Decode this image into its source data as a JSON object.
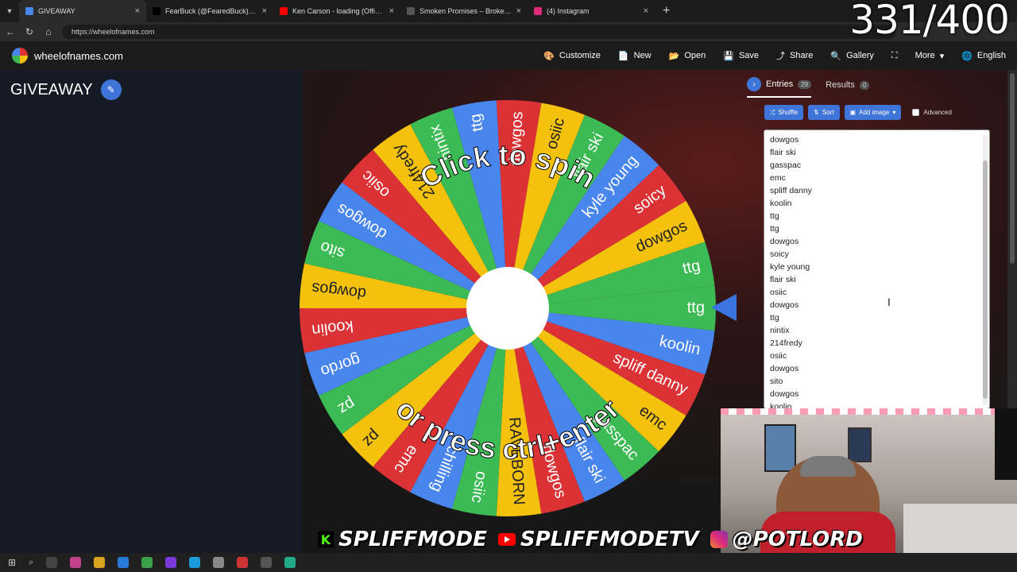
{
  "browser": {
    "tabs": [
      {
        "title": "GIVEAWAY",
        "fav": "#4885ed",
        "active": true
      },
      {
        "title": "FearBuck (@FearedBuck) / X",
        "fav": "#000000"
      },
      {
        "title": "Ken Carson - loading (Official",
        "fav": "#ff0000"
      },
      {
        "title": "Smoken Promises – Broken Promi",
        "fav": "#555555"
      },
      {
        "title": "(4) Instagram",
        "fav": "#dd2a7b"
      }
    ],
    "url": "https://wheelofnames.com"
  },
  "site": {
    "logo_text": "wheelofnames.com",
    "menu": [
      {
        "icon": "palette-icon",
        "glyph": "🎨",
        "label": "Customize"
      },
      {
        "icon": "new-file-icon",
        "glyph": "📄",
        "label": "New"
      },
      {
        "icon": "folder-icon",
        "glyph": "📂",
        "label": "Open"
      },
      {
        "icon": "save-icon",
        "glyph": "💾",
        "label": "Save"
      },
      {
        "icon": "share-icon",
        "glyph": "⤴",
        "label": "Share"
      },
      {
        "icon": "search-icon",
        "glyph": "🔍",
        "label": "Gallery"
      },
      {
        "icon": "fullscreen-icon",
        "glyph": "⛶",
        "label": ""
      },
      {
        "icon": "chevron-down-icon",
        "glyph": "▾",
        "label": "More"
      },
      {
        "icon": "globe-icon",
        "glyph": "🌐",
        "label": "English"
      }
    ]
  },
  "wheel": {
    "title": "GIVEAWAY",
    "click_text": "Click to spin",
    "press_text": "or press ctrl+enter",
    "colors": [
      "#3cba54",
      "#4885ed",
      "#db3236",
      "#f4c20d"
    ],
    "segments": [
      "ttg",
      "koolin",
      "spliff danny",
      "emc",
      "gasspac",
      "flair ski",
      "dowgos",
      "RAVEBORN",
      "osiic",
      "chilling",
      "emc",
      "pz",
      "pz",
      "gordo",
      "koolin",
      "dowgos",
      "sito",
      "dowgos",
      "osiic",
      "214fredy",
      "nintix",
      "ttg",
      "dowgos",
      "osiic",
      "flair ski",
      "kyle young",
      "soicy",
      "dowgos",
      "ttg"
    ]
  },
  "panel": {
    "entries_tab": "Entries",
    "entries_count": "29",
    "results_tab": "Results",
    "results_count": "0",
    "shuffle": "Shuffle",
    "sort": "Sort",
    "add_image": "Add image",
    "advanced": "Advanced",
    "entries": [
      "dowgos",
      "flair ski",
      "gasspac",
      "emc",
      "spliff danny",
      "koolin",
      "ttg",
      "ttg",
      "dowgos",
      "soicy",
      "kyle young",
      "flair ski",
      "osiic",
      "dowgos",
      "ttg",
      "nintix",
      "214fredy",
      "osiic",
      "dowgos",
      "sito",
      "dowgos",
      "koolin"
    ]
  },
  "overlay": {
    "counter": "331/400",
    "social": [
      {
        "icon": "kick-icon",
        "label": "SPLIFFMODE"
      },
      {
        "icon": "youtube-icon",
        "label": "SPLIFFMODETV"
      },
      {
        "icon": "instagram-icon",
        "label": "@POTLORD"
      }
    ]
  }
}
